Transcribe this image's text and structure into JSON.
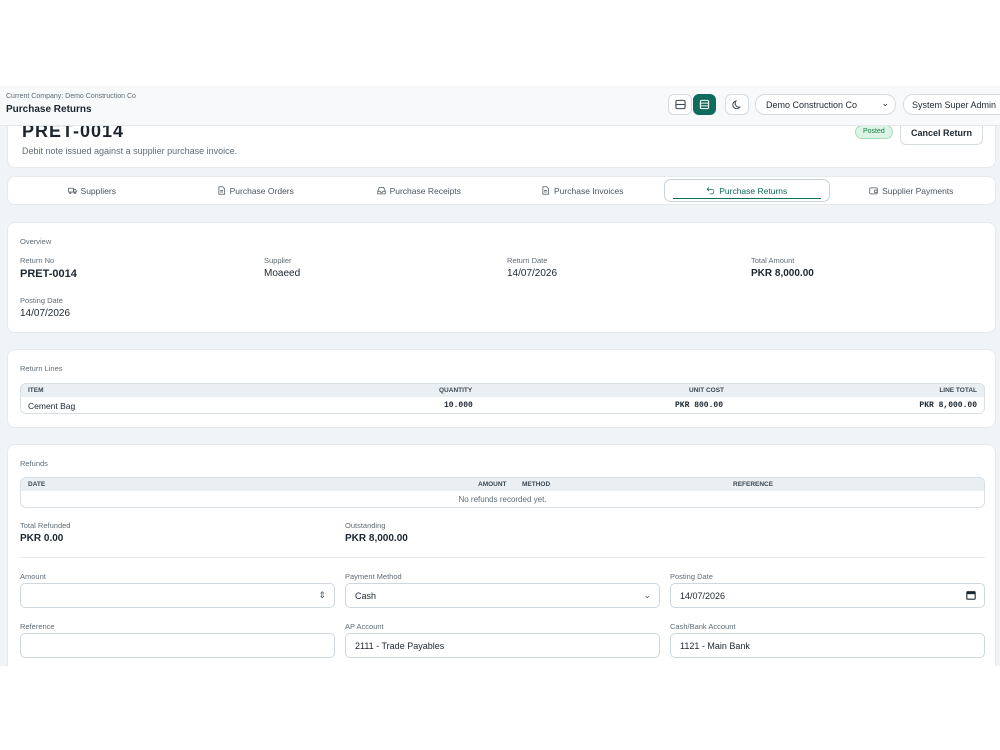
{
  "header": {
    "company_line": "Current Company: Demo Construction Co",
    "page_title": "Purchase Returns",
    "company_select": "Demo Construction Co",
    "user_label": "System Super Admin"
  },
  "document": {
    "number": "PRET-0014",
    "subtitle": "Debit note issued against a supplier purchase invoice.",
    "status_badge": "Posted",
    "cancel_label": "Cancel Return"
  },
  "tabs": [
    {
      "label": "Suppliers",
      "icon": "truck-icon"
    },
    {
      "label": "Purchase Orders",
      "icon": "file-icon"
    },
    {
      "label": "Purchase Receipts",
      "icon": "inbox-icon"
    },
    {
      "label": "Purchase Invoices",
      "icon": "file-icon"
    },
    {
      "label": "Purchase Returns",
      "icon": "undo-icon",
      "active": true
    },
    {
      "label": "Supplier Payments",
      "icon": "wallet-icon"
    }
  ],
  "overview": {
    "section_label": "Overview",
    "return_no_label": "Return No",
    "return_no": "PRET-0014",
    "supplier_label": "Supplier",
    "supplier": "Moaeed",
    "return_date_label": "Return Date",
    "return_date": "14/07/2026",
    "total_label": "Total Amount",
    "total": "PKR 8,000.00",
    "posting_date_label": "Posting Date",
    "posting_date": "14/07/2026"
  },
  "return_lines": {
    "section_label": "Return Lines",
    "columns": [
      "ITEM",
      "QUANTITY",
      "UNIT COST",
      "LINE TOTAL"
    ],
    "rows": [
      {
        "item": "Cement Bag",
        "quantity": "10.000",
        "unit_cost": "PKR 800.00",
        "line_total": "PKR 8,000.00"
      }
    ]
  },
  "refunds": {
    "section_label": "Refunds",
    "columns": [
      "DATE",
      "AMOUNT",
      "METHOD",
      "REFERENCE"
    ],
    "empty_message": "No refunds recorded yet.",
    "total_refunded_label": "Total Refunded",
    "total_refunded": "PKR 0.00",
    "outstanding_label": "Outstanding",
    "outstanding": "PKR 8,000.00",
    "form": {
      "amount_label": "Amount",
      "amount_value": "",
      "payment_method_label": "Payment Method",
      "payment_method_value": "Cash",
      "posting_date_label": "Posting Date",
      "posting_date_value": "14/07/2026",
      "reference_label": "Reference",
      "reference_value": "",
      "ap_account_label": "AP Account",
      "ap_account_value": "2111 - Trade Payables",
      "cash_account_label": "Cash/Bank Account",
      "cash_account_value": "1121 - Main Bank"
    }
  },
  "colors": {
    "accent": "#0f6b5c",
    "posted_badge_bg": "#dcf4e6",
    "posted_badge_text": "#1b7a44",
    "page_bg": "#f1f4f6"
  }
}
